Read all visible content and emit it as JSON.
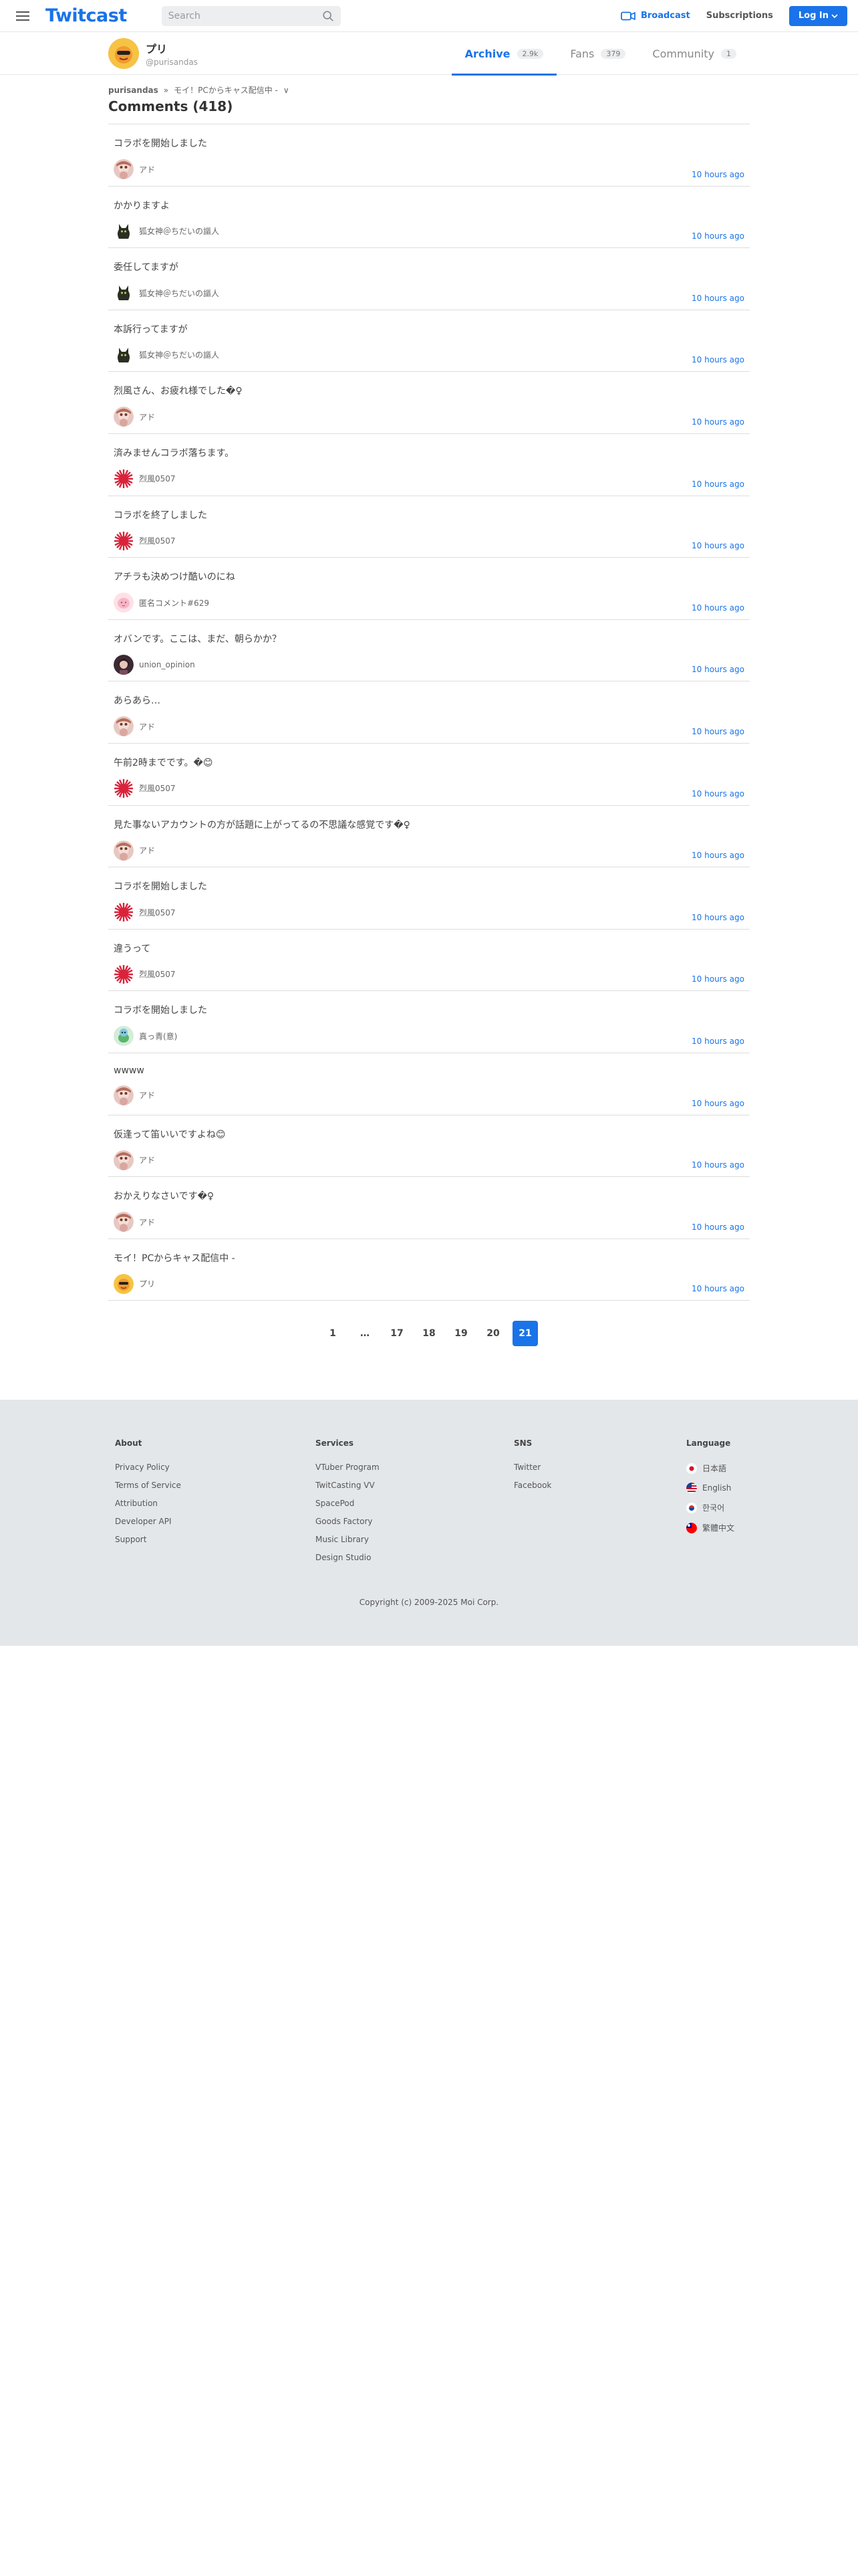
{
  "header": {
    "logo": "Twitcast",
    "search_placeholder": "Search",
    "broadcast": "Broadcast",
    "subscriptions": "Subscriptions",
    "login": "Log In"
  },
  "profile": {
    "name": "プリ",
    "handle": "@purisandas",
    "tabs": [
      {
        "label": "Archive",
        "count": "2.9k"
      },
      {
        "label": "Fans",
        "count": "379"
      },
      {
        "label": "Community",
        "count": "1"
      }
    ]
  },
  "breadcrumb": {
    "user": "purisandas",
    "separator": "»",
    "item": "モイ！PCからキャス配信中 -",
    "chevron": "∨"
  },
  "page_title": "Comments (418)",
  "comments": [
    {
      "text": "コラボを開始しました",
      "author": "アド",
      "time": "10 hours ago",
      "avatar": "pink-face"
    },
    {
      "text": "かかりますよ",
      "author": "狐女神＠ちだいの謳人",
      "time": "10 hours ago",
      "avatar": "dark-figure"
    },
    {
      "text": "委任してますが",
      "author": "狐女神＠ちだいの謳人",
      "time": "10 hours ago",
      "avatar": "dark-figure"
    },
    {
      "text": "本訴行ってますが",
      "author": "狐女神＠ちだいの謳人",
      "time": "10 hours ago",
      "avatar": "dark-figure"
    },
    {
      "text": "烈風さん、お疲れ様でした�♀",
      "author": "アド",
      "time": "10 hours ago",
      "avatar": "pink-face"
    },
    {
      "text": "済みませんコラボ落ちます。",
      "author": "烈風0507",
      "time": "10 hours ago",
      "avatar": "red-sun"
    },
    {
      "text": "コラボを終了しました",
      "author": "烈風0507",
      "time": "10 hours ago",
      "avatar": "red-sun"
    },
    {
      "text": "アチラも決めつけ酷いのにね",
      "author": "匿名コメント#629",
      "time": "10 hours ago",
      "avatar": "pink-blob"
    },
    {
      "text": "オバンです。ここは、まだ、朝らかか？",
      "author": "union_opinion",
      "time": "10 hours ago",
      "avatar": "portrait"
    },
    {
      "text": "あらあら…",
      "author": "アド",
      "time": "10 hours ago",
      "avatar": "pink-face"
    },
    {
      "text": "午前2時までです。�😊",
      "author": "烈風0507",
      "time": "10 hours ago",
      "avatar": "red-sun"
    },
    {
      "text": "見た事ないアカウントの方が話題に上がってるの不思議な感覚です�♀",
      "author": "アド",
      "time": "10 hours ago",
      "avatar": "pink-face"
    },
    {
      "text": "コラボを開始しました",
      "author": "烈風0507",
      "time": "10 hours ago",
      "avatar": "red-sun"
    },
    {
      "text": "違うって",
      "author": "烈風0507",
      "time": "10 hours ago",
      "avatar": "red-sun"
    },
    {
      "text": "コラボを開始しました",
      "author": "真っ青(意)",
      "time": "10 hours ago",
      "avatar": "green-char"
    },
    {
      "text": "wwww",
      "author": "アド",
      "time": "10 hours ago",
      "avatar": "pink-face"
    },
    {
      "text": "仮逢って笛いいですよね😊",
      "author": "アド",
      "time": "10 hours ago",
      "avatar": "pink-face"
    },
    {
      "text": "おかえりなさいです�♀",
      "author": "アド",
      "time": "10 hours ago",
      "avatar": "pink-face"
    },
    {
      "text": "モイ！PCからキャス配信中 -",
      "author": "プリ",
      "time": "10 hours ago",
      "avatar": "sun-owner"
    }
  ],
  "pagination": [
    {
      "label": "1",
      "active": false
    },
    {
      "label": "…",
      "active": false
    },
    {
      "label": "17",
      "active": false
    },
    {
      "label": "18",
      "active": false
    },
    {
      "label": "19",
      "active": false
    },
    {
      "label": "20",
      "active": false
    },
    {
      "label": "21",
      "active": true
    }
  ],
  "footer": {
    "about": {
      "title": "About",
      "links": [
        "Privacy Policy",
        "Terms of Service",
        "Attribution",
        "Developer API",
        "Support"
      ]
    },
    "services": {
      "title": "Services",
      "links": [
        "VTuber Program",
        "TwitCasting VV",
        "SpacePod",
        "Goods Factory",
        "Music Library",
        "Design Studio"
      ]
    },
    "sns": {
      "title": "SNS",
      "links": [
        "Twitter",
        "Facebook"
      ]
    },
    "language": {
      "title": "Language",
      "links": [
        {
          "label": "日本語",
          "flag": "jp"
        },
        {
          "label": "English",
          "flag": "us"
        },
        {
          "label": "한국어",
          "flag": "kr"
        },
        {
          "label": "繁體中文",
          "flag": "tw"
        }
      ]
    },
    "copyright": "Copyright (c) 2009-2025 Moi Corp."
  },
  "colors": {
    "accent": "#1a73e8",
    "footer_bg": "#e4e7ea",
    "divider": "#dddddd"
  }
}
